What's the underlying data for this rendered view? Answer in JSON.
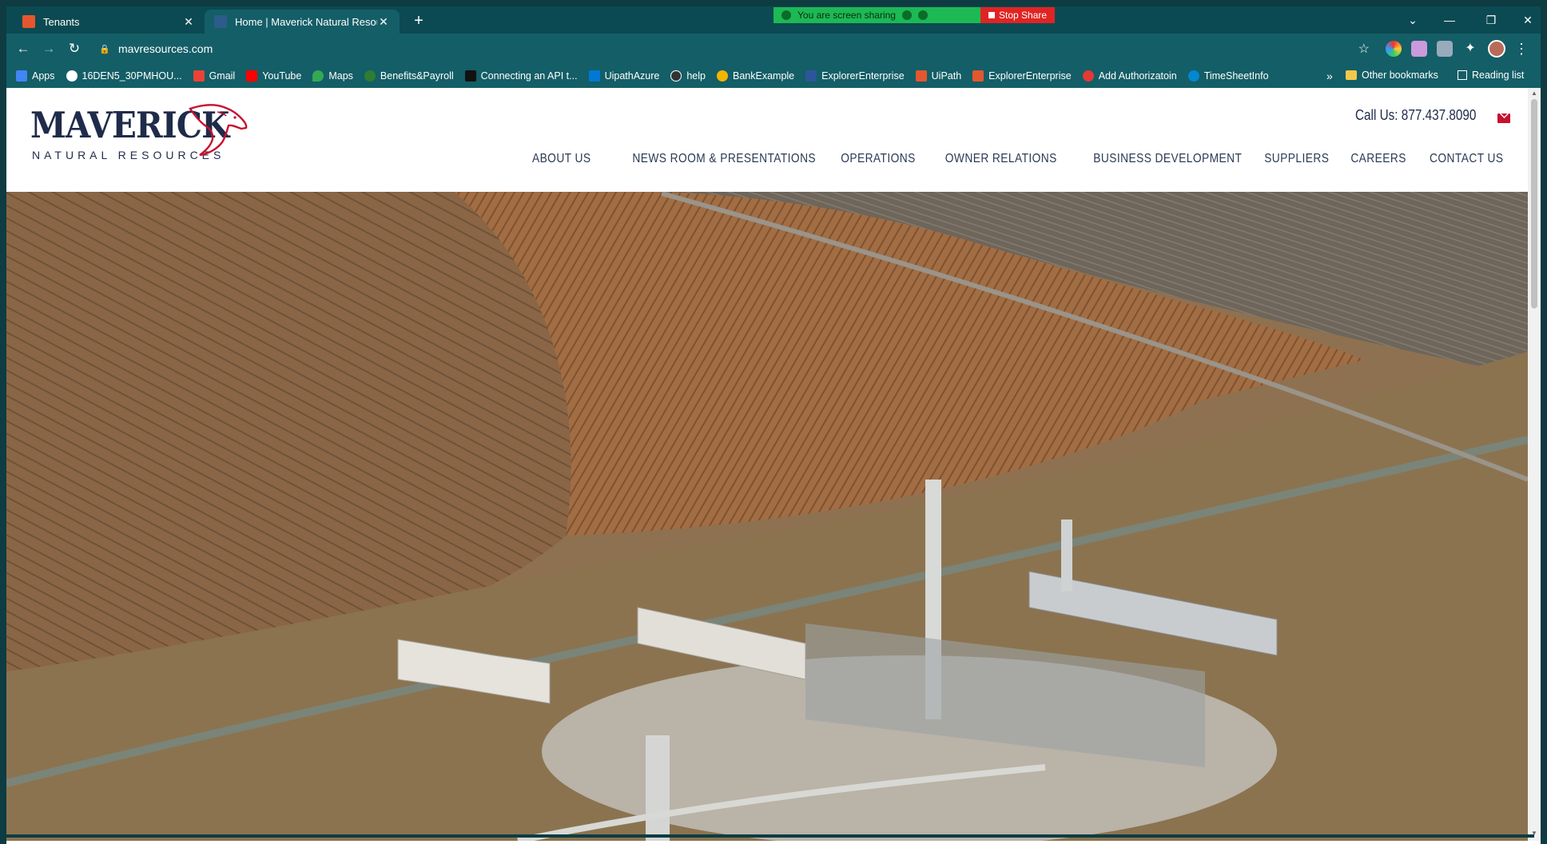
{
  "browser": {
    "tabs": [
      {
        "title": "Tenants",
        "favicon_color": "#e4572e"
      },
      {
        "title": "Home | Maverick Natural Resour",
        "favicon_color": "#2b5c8a",
        "active": true
      }
    ],
    "screen_share": {
      "message": "You are screen sharing",
      "stop_label": "Stop Share"
    },
    "url": "mavresources.com",
    "bookmarks": [
      {
        "label": "Apps",
        "color": "#4285f4"
      },
      {
        "label": "16DEN5_30PMHOU...",
        "color": "#ffffff"
      },
      {
        "label": "Gmail",
        "color": "#ea4335"
      },
      {
        "label": "YouTube",
        "color": "#ff0000"
      },
      {
        "label": "Maps",
        "color": "#34a853"
      },
      {
        "label": "Benefits&Payroll",
        "color": "#2e7d32"
      },
      {
        "label": "Connecting an API t...",
        "color": "#111111"
      },
      {
        "label": "UipathAzure",
        "color": "#0078d4"
      },
      {
        "label": "help",
        "color": "#333333"
      },
      {
        "label": "BankExample",
        "color": "#f4b400"
      },
      {
        "label": "ExplorerEnterprise",
        "color": "#2b579a"
      },
      {
        "label": "UiPath",
        "color": "#e4572e"
      },
      {
        "label": "ExplorerEnterprise",
        "color": "#e4572e"
      },
      {
        "label": "Add Authorizatoin",
        "color": "#e53935"
      },
      {
        "label": "TimeSheetInfo",
        "color": "#0288d1"
      }
    ],
    "other_bookmarks": "Other bookmarks",
    "reading_list": "Reading list"
  },
  "site": {
    "logo_word": "MAVERICK",
    "logo_sub": "NATURAL RESOURCES",
    "phone": "Call Us: 877.437.8090",
    "nav": [
      "ABOUT US",
      "NEWS ROOM & PRESENTATIONS",
      "OPERATIONS",
      "OWNER RELATIONS",
      "BUSINESS DEVELOPMENT",
      "SUPPLIERS",
      "CAREERS",
      "CONTACT US"
    ]
  },
  "colors": {
    "brand_navy": "#1f2b4a",
    "brand_red": "#c8102e",
    "chrome_teal": "#145e67"
  }
}
